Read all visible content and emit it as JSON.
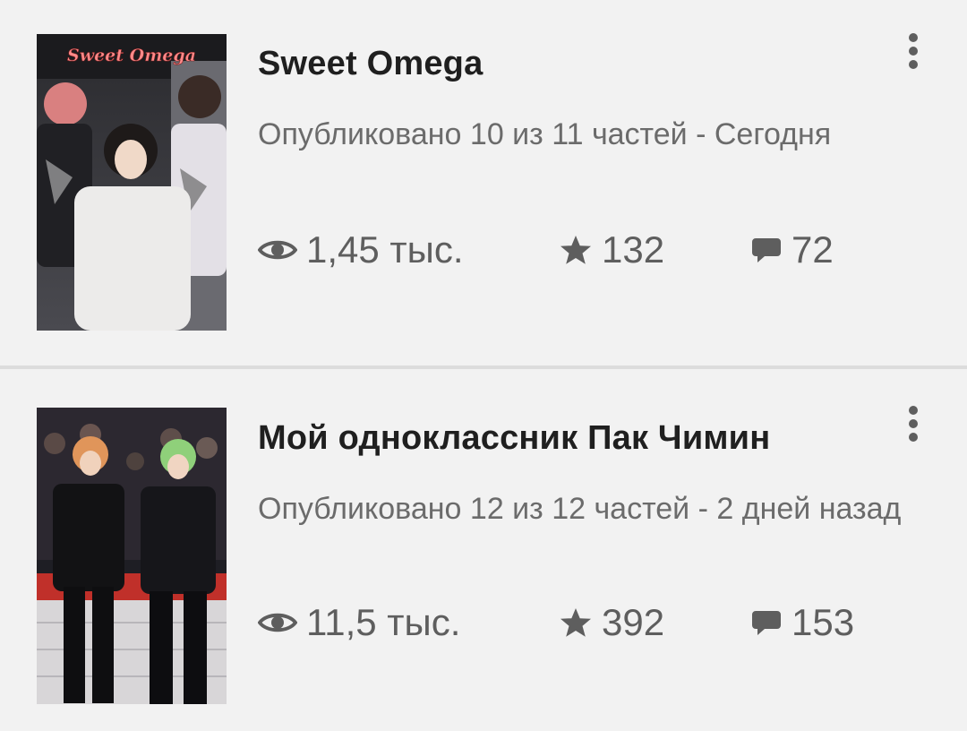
{
  "stories": [
    {
      "title": "Sweet Omega",
      "cover_text": "Sweet Omega",
      "meta": "Опубликовано 10 из 11 частей - Сегодня",
      "reads": "1,45 тыс.",
      "votes": "132",
      "comments": "72"
    },
    {
      "title": "Мой одноклассник Пак Чимин",
      "meta": "Опубликовано 12 из 12 частей - 2 дней назад",
      "reads": "11,5 тыс.",
      "votes": "392",
      "comments": "153"
    }
  ],
  "icons": {
    "reads": "eye-icon",
    "votes": "star-icon",
    "comments": "comment-icon",
    "menu": "more-vertical-icon"
  },
  "colors": {
    "background": "#f2f2f2",
    "title": "#1f1f1f",
    "meta": "#6b6b6b",
    "stats": "#5e5e5e",
    "divider": "#dcdcdc"
  }
}
